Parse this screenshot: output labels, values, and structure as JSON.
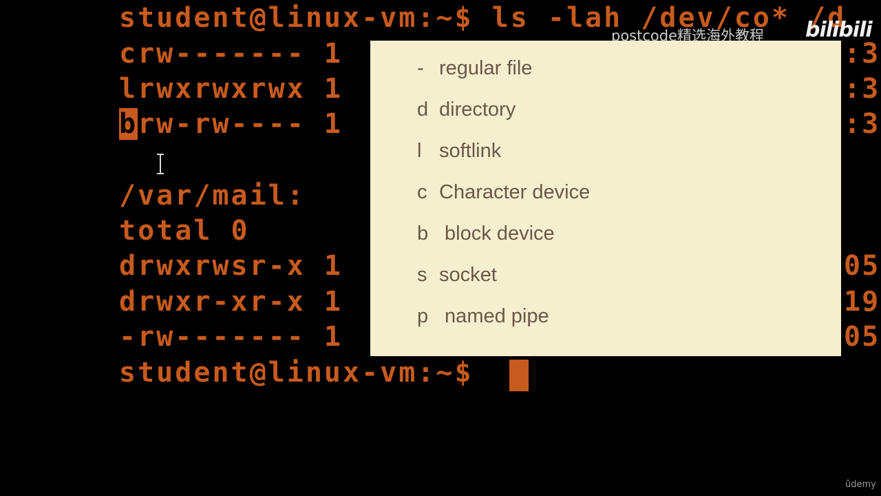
{
  "terminal": {
    "colors": {
      "text": "#c75a1e",
      "background": "#000000",
      "highlight_text": "#000000"
    },
    "lines": [
      "student@linux-vm:~$ ls -lah /dev/co* /d",
      "crw------- 1",
      "lrwxrwxrwx 1",
      "",
      "",
      "/var/mail:",
      "total 0",
      "drwxrwsr-x 1",
      "drwxr-xr-x 1",
      "-rw------- 1",
      "student@linux-vm:~$"
    ],
    "highlight_line": {
      "first_char": "b",
      "rest": "rw-rw---- 1"
    },
    "right_fragments": [
      ":3",
      ":3",
      ":3",
      "05",
      "19",
      "05"
    ]
  },
  "overlay": {
    "background": "#f6efcf",
    "text_color": "#6a5848",
    "items": [
      {
        "key": "-",
        "label": "regular file"
      },
      {
        "key": "d",
        "label": "directory"
      },
      {
        "key": "l",
        "label": "softlink"
      },
      {
        "key": "c",
        "label": "Character device"
      },
      {
        "key": "b",
        "label": " block device"
      },
      {
        "key": "s",
        "label": "socket"
      },
      {
        "key": "p",
        "label": " named pipe"
      }
    ]
  },
  "watermark": {
    "text": "postcode精选海外教程",
    "logo_text": "bilibili"
  },
  "footer": {
    "brand": "ûdemy"
  },
  "icons": {
    "cursor": "text-ibeam-cursor-icon",
    "terminal_cursor": "block-cursor-icon",
    "logo": "bilibili-logo-icon"
  }
}
